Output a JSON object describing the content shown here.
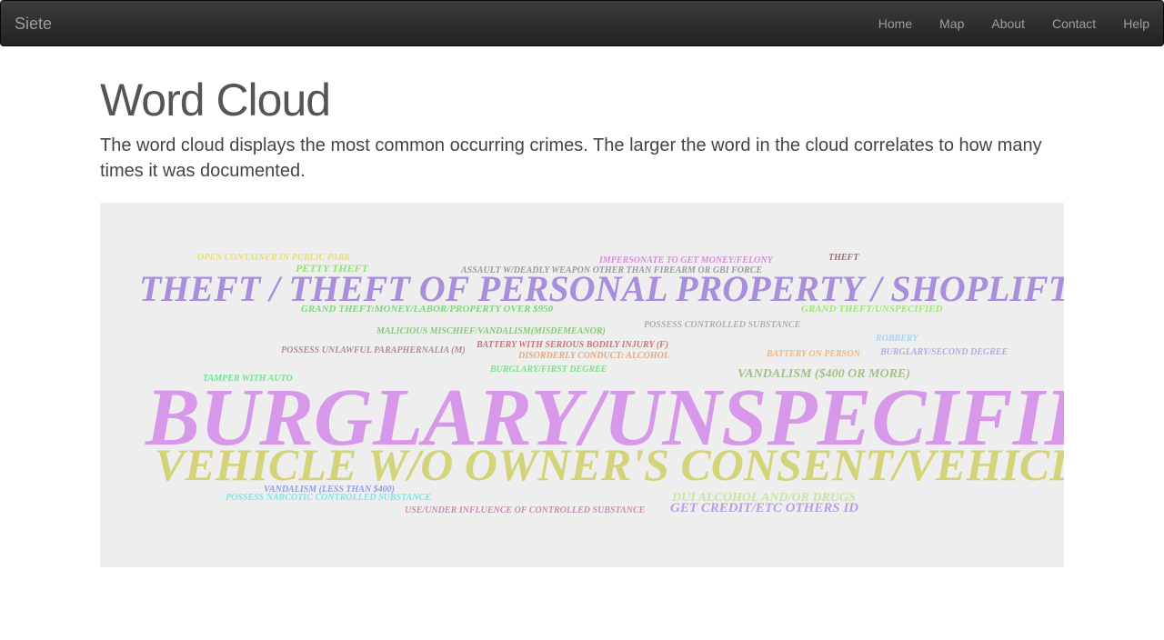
{
  "navbar": {
    "brand": "Siete",
    "items": [
      "Home",
      "Map",
      "About",
      "Contact",
      "Help"
    ]
  },
  "main": {
    "title": "Word Cloud",
    "lead": "The word cloud displays the most common occurring crimes. The larger the word in the cloud correlates to how many times it was documented."
  },
  "word_cloud": {
    "background": "#eeeeee",
    "words": [
      {
        "text": "OPEN CONTAINER IN PUBLIC PARK",
        "color": "#e6e16a"
      },
      {
        "text": "PETTY THEFT",
        "color": "#8ee36f"
      },
      {
        "text": "IMPERSONATE TO GET MONEY/FELONY",
        "color": "#d390d8"
      },
      {
        "text": "THEFT",
        "color": "#a0716e"
      },
      {
        "text": "ASSAULT W/DEADLY WEAPON OTHER THAN FIREARM OR GBI FORCE",
        "color": "#9c9ca0"
      },
      {
        "text": "THEFT / THEFT OF PERSONAL PROPERTY / SHOPLIFTING",
        "color": "#a88edb"
      },
      {
        "text": "GRAND THEFT:MONEY/LABOR/PROPERTY OVER $950",
        "color": "#7fd67b"
      },
      {
        "text": "GRAND THEFT/UNSPECIFIED",
        "color": "#9ce878"
      },
      {
        "text": "MALICIOUS MISCHIEF/VANDALISM(MISDEMEANOR)",
        "color": "#88c97a"
      },
      {
        "text": "POSSESS CONTROLLED SUBSTANCE",
        "color": "#a9b1b4"
      },
      {
        "text": "POSSESS UNLAWFUL PARAPHERNALIA (M)",
        "color": "#b48aa2"
      },
      {
        "text": "BATTERY WITH SERIOUS BODILY INJURY (F)",
        "color": "#d97070"
      },
      {
        "text": "DISORDERLY CONDUCT: ALCOHOL",
        "color": "#e8a77a"
      },
      {
        "text": "ROBBERY",
        "color": "#a8d3f0"
      },
      {
        "text": "BATTERY ON PERSON",
        "color": "#f0b87a"
      },
      {
        "text": "BURGLARY/SECOND DEGREE",
        "color": "#b9a8e8"
      },
      {
        "text": "BURGLARY/FIRST DEGREE",
        "color": "#7fe08c"
      },
      {
        "text": "TAMPER WITH AUTO",
        "color": "#74e09a"
      },
      {
        "text": "VANDALISM ($400 OR MORE)",
        "color": "#a6bf8c"
      },
      {
        "text": "BURGLARY/UNSPECIFIED",
        "color": "#d898ea"
      },
      {
        "text": "VEHICLE W/O OWNER'S CONSENT/VEHICLE THEFT",
        "color": "#d3d37a"
      },
      {
        "text": "VANDALISM (LESS THAN $400)",
        "color": "#8e9ee0"
      },
      {
        "text": "POSSESS NARCOTIC CONTROLLED SUBSTANCE",
        "color": "#7ae8e4"
      },
      {
        "text": "DUI ALCOHOL AND/OR DRUGS",
        "color": "#c9e3a8"
      },
      {
        "text": "GET CREDIT/ETC OTHERS ID",
        "color": "#b8a0e0"
      },
      {
        "text": "USE/UNDER INFLUENCE OF CONTROLLED SUBSTANCE",
        "color": "#d18ab8"
      }
    ]
  }
}
